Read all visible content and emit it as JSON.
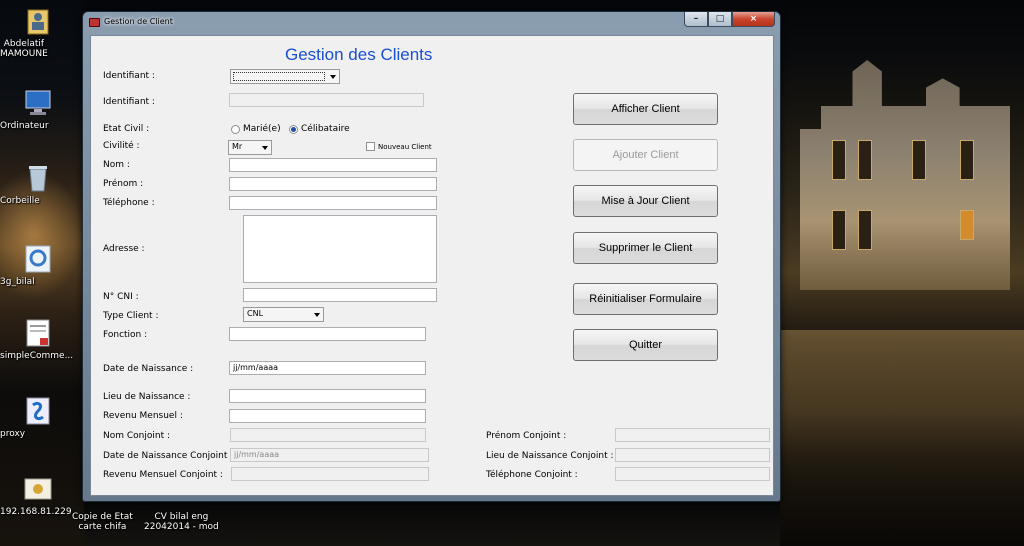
{
  "desktop": {
    "icons": [
      {
        "label": "Abdelatif\nMAMOUNE"
      },
      {
        "label": "Ordinateur"
      },
      {
        "label": "Corbeille"
      },
      {
        "label": "3g_bilal"
      },
      {
        "label": "simpleComme..."
      },
      {
        "label": "proxy"
      },
      {
        "label": "192.168.81.229"
      },
      {
        "label": "Copie de Etat\ncarte chifa"
      },
      {
        "label": "CV bilal eng\n22042014 - mod"
      }
    ]
  },
  "window": {
    "title": "Gestion de Client",
    "heading": "Gestion des Clients",
    "caption": {
      "minimize": "–",
      "maximize": "□",
      "close": "×"
    }
  },
  "form": {
    "identifiant_combo_label": "Identifiant :",
    "identifiant_combo_value": "",
    "identifiant_label": "Identifiant :",
    "identifiant_value": "",
    "etat_civil_label": "Etat Civil :",
    "etat_civil_options": [
      "Marié(e)",
      "Célibataire"
    ],
    "etat_civil_selected": "Célibataire",
    "civilite_label": "Civilité :",
    "civilite_value": "Mr",
    "nouveau_client_label": "Nouveau Client",
    "nom_label": "Nom :",
    "prenom_label": "Prénom :",
    "telephone_label": "Téléphone :",
    "adresse_label": "Adresse :",
    "cni_label": "N° CNI :",
    "type_client_label": "Type Client :",
    "type_client_value": "CNL",
    "fonction_label": "Fonction :",
    "date_naissance_label": "Date de Naissance :",
    "date_naissance_value": "jj/mm/aaaa",
    "lieu_naissance_label": "Lieu de Naissance :",
    "revenu_label": "Revenu Mensuel :",
    "nom_conjoint_label": "Nom Conjoint :",
    "date_naissance_conjoint_label": "Date de Naissance Conjoint :",
    "date_naissance_conjoint_value": "jj/mm/aaaa",
    "revenu_conjoint_label": "Revenu Mensuel Conjoint :",
    "prenom_conjoint_label": "Prénom Conjoint :",
    "lieu_naissance_conjoint_label": "Lieu de Naissance Conjoint :",
    "telephone_conjoint_label": "Téléphone Conjoint :"
  },
  "buttons": {
    "afficher": "Afficher Client",
    "ajouter": "Ajouter Client",
    "maj": "Mise à Jour Client",
    "supprimer": "Supprimer le Client",
    "reinitialiser": "Réinitialiser Formulaire",
    "quitter": "Quitter"
  },
  "colors": {
    "heading": "#1a4fd0",
    "close_button": "#c9452e",
    "window_frame": "#8a9bb0"
  }
}
